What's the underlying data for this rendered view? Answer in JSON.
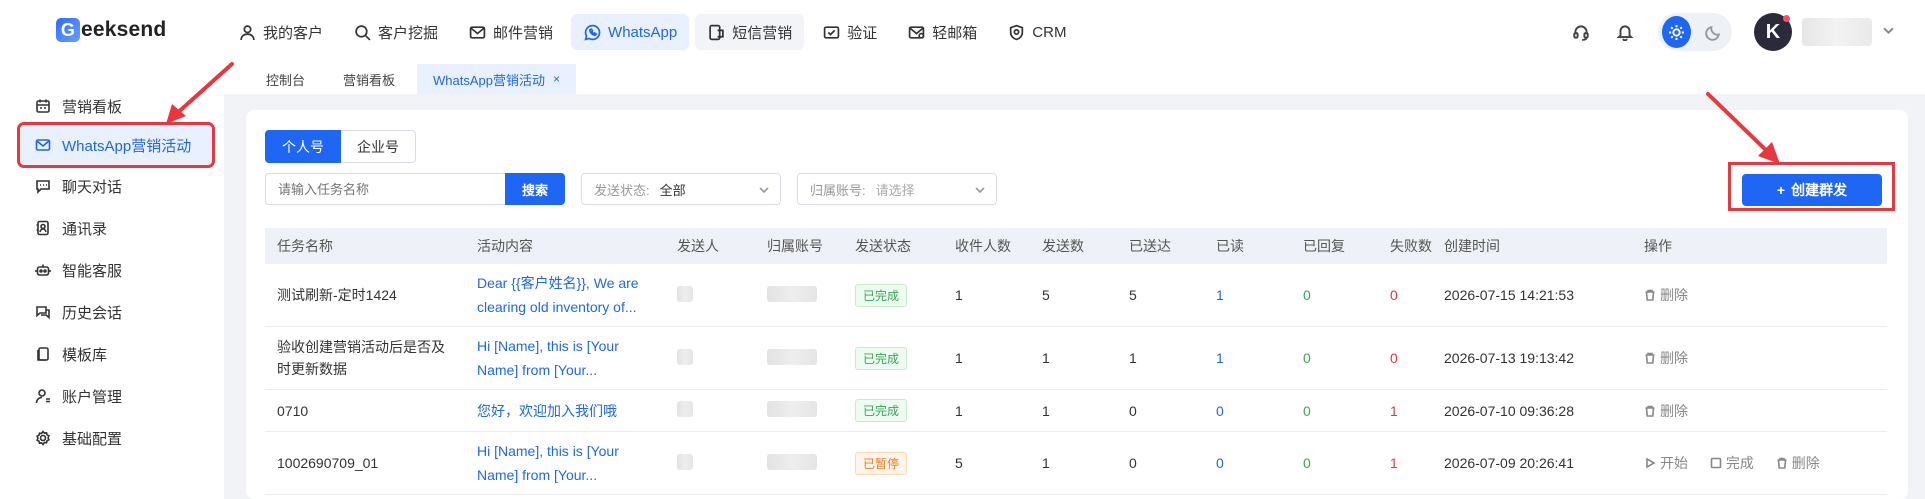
{
  "brand": {
    "logo_letter": "G",
    "logo_rest": "eeksend"
  },
  "nav": [
    {
      "label": "我的客户",
      "icon": "user-icon"
    },
    {
      "label": "客户挖掘",
      "icon": "search-icon"
    },
    {
      "label": "邮件营销",
      "icon": "mail-icon"
    },
    {
      "label": "WhatsApp",
      "icon": "whatsapp-icon"
    },
    {
      "label": "短信营销",
      "icon": "sms-icon"
    },
    {
      "label": "验证",
      "icon": "verify-icon"
    },
    {
      "label": "轻邮箱",
      "icon": "light-mail-icon"
    },
    {
      "label": "CRM",
      "icon": "crm-icon"
    }
  ],
  "sidebar": [
    {
      "label": "营销看板",
      "icon": "calendar-icon"
    },
    {
      "label": "WhatsApp营销活动",
      "icon": "campaign-icon"
    },
    {
      "label": "聊天对话",
      "icon": "chat-icon"
    },
    {
      "label": "通讯录",
      "icon": "contacts-icon"
    },
    {
      "label": "智能客服",
      "icon": "robot-icon"
    },
    {
      "label": "历史会话",
      "icon": "history-icon"
    },
    {
      "label": "模板库",
      "icon": "template-icon"
    },
    {
      "label": "账户管理",
      "icon": "account-icon"
    },
    {
      "label": "基础配置",
      "icon": "settings-icon"
    }
  ],
  "page_tabs": [
    {
      "label": "控制台"
    },
    {
      "label": "营销看板"
    },
    {
      "label": "WhatsApp营销活动",
      "close": "×"
    }
  ],
  "account_type": {
    "personal": "个人号",
    "business": "企业号"
  },
  "filters": {
    "search_placeholder": "请输入任务名称",
    "search_button": "搜索",
    "status_label": "发送状态:",
    "status_value": "全部",
    "account_label": "归属账号:",
    "account_placeholder": "请选择"
  },
  "create_button": {
    "plus": "+",
    "label": "创建群发"
  },
  "table": {
    "columns": [
      "任务名称",
      "活动内容",
      "发送人",
      "归属账号",
      "发送状态",
      "收件人数",
      "发送数",
      "已送达",
      "已读",
      "已回复",
      "失败数",
      "创建时间",
      "操作"
    ],
    "rows": [
      {
        "name": "测试刷新-定时1424",
        "content_line1": "Dear {{客户姓名}}, We are",
        "content_line2": "clearing old inventory of...",
        "status": "已完成",
        "status_kind": "done",
        "recipients": "1",
        "sent": "5",
        "delivered": "5",
        "read": "1",
        "replied": "0",
        "failed": "0",
        "created": "2026-07-15 14:21:53",
        "ops": [
          "删除"
        ]
      },
      {
        "name": "验收创建营销活动后是否及时更新数据",
        "name_line1": "验收创建营销活动后是否及",
        "name_line2": "时更新数据",
        "content_line1": "Hi [Name], this is [Your",
        "content_line2": "Name] from [Your...",
        "status": "已完成",
        "status_kind": "done",
        "recipients": "1",
        "sent": "1",
        "delivered": "1",
        "read": "1",
        "replied": "0",
        "failed": "0",
        "created": "2026-07-13 19:13:42",
        "ops": [
          "删除"
        ]
      },
      {
        "name": "0710",
        "content_line1": "您好，欢迎加入我们哦",
        "content_line2": "",
        "status": "已完成",
        "status_kind": "done",
        "recipients": "1",
        "sent": "1",
        "delivered": "0",
        "read": "0",
        "replied": "0",
        "failed": "1",
        "created": "2026-07-10 09:36:28",
        "ops": [
          "删除"
        ]
      },
      {
        "name": "1002690709_01",
        "content_line1": "Hi [Name], this is [Your",
        "content_line2": "Name] from [Your...",
        "status": "已暂停",
        "status_kind": "paused",
        "recipients": "5",
        "sent": "1",
        "delivered": "0",
        "read": "0",
        "replied": "0",
        "failed": "1",
        "created": "2026-07-09 20:26:41",
        "ops": [
          "开始",
          "完成",
          "删除"
        ]
      }
    ]
  },
  "colors": {
    "primary": "#1f66f5",
    "annotation": "#e8383d",
    "success": "#3aa757",
    "warning": "#f07b27",
    "danger": "#e53a3a"
  }
}
